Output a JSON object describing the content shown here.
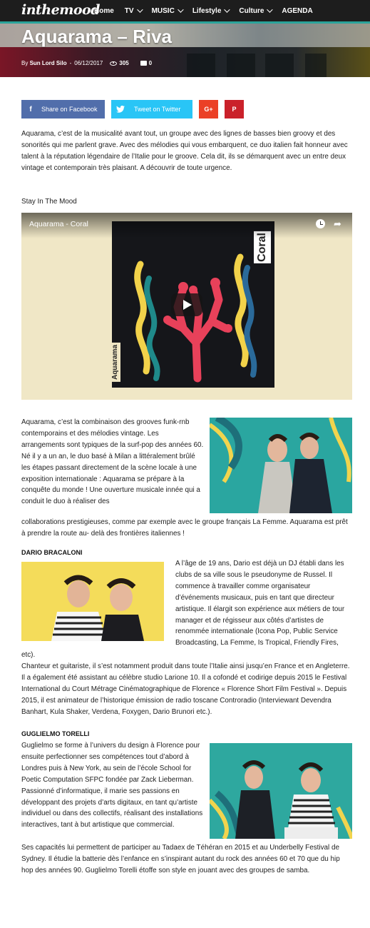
{
  "site": {
    "logo": "inthemood",
    "nav": [
      {
        "label": "Home",
        "has_dropdown": false
      },
      {
        "label": "TV",
        "has_dropdown": true
      },
      {
        "label": "MUSIC",
        "has_dropdown": true
      },
      {
        "label": "Lifestyle",
        "has_dropdown": true
      },
      {
        "label": "Culture",
        "has_dropdown": true
      },
      {
        "label": "AGENDA",
        "has_dropdown": false
      }
    ],
    "accent": "#2aa39a"
  },
  "article": {
    "title": "Aquarama – Riva",
    "by": "By",
    "author": "Sun Lord Silo",
    "date_sep": "-",
    "date": "06/12/2017",
    "views": "305",
    "comments": "0"
  },
  "share": {
    "facebook_label": "Share on Facebook",
    "twitter_label": "Tweet on Twitter",
    "googleplus_label": "G+",
    "pinterest_label": "P",
    "facebook_icon": "f",
    "colors": {
      "facebook": "#516eab",
      "twitter": "#29c5f6",
      "googleplus": "#eb4026",
      "pinterest": "#ca212a"
    }
  },
  "content": {
    "intro": "Aquarama, c’est de la musicalité avant tout, un groupe avec des lignes de basses bien groovy et des sonorités qui me parlent grave. Avec des mélodies qui vous embarquent, ce duo italien fait honneur avec talent à la réputation légendaire de l’Italie pour le groove. Cela dit, ils se démarquent avec un entre deux vintage et contemporain très plaisant. A découvrir de toute urgence.",
    "stay": "Stay In The Mood",
    "video": {
      "title": "Aquarama - Coral",
      "cover_title": "Coral",
      "cover_artist": "Aquarama"
    },
    "para2": "Aquarama, c’est la combinaison des grooves funk-rnb contemporains et des mélodies vintage. Les arrangements sont typiques de la surf-pop des années 60. Né il y a un an, le duo basé à Milan a littéralement brûlé les étapes passant directement de la scène locale à une exposition internationale : Aquarama se prépare à la conquête du monde ! Une ouverture musicale innée qui a conduit le duo à réaliser des",
    "para2b": "collaborations prestigieuses, comme par exemple avec le groupe français La Femme. Aquarama est prêt à prendre la route au- delà des frontières italiennes !",
    "dario_heading": "DARIO BRACALONI",
    "dario_p1": "A l’âge de 19 ans, Dario est déjà un DJ établi dans les clubs de sa ville sous le pseudonyme de Russel. Il commence à travailler comme organisateur d’événements musicaux, puis en tant que directeur artistique. Il élargit son expérience aux métiers de tour manager et de régisseur aux côtés d’artistes de renommée internationale (Icona Pop, Public Service Broadcasting, La Femme, Is Tropical, Friendly Fires,",
    "dario_p1b": "etc).",
    "dario_p2": "Chanteur et guitariste, il s’est notamment produit dans toute l’Italie ainsi jusqu’en France et en Angleterre. Il a également été assistant au célèbre studio Larione 10. Il a cofondé et codirige depuis 2015 le Festival International du Court Métrage Cinématographique de Florence « Florence Short Film Festival ». Depuis 2015, il est animateur de l’historique émission de radio toscane Controradio (Interviewant Devendra Banhart, Kula Shaker, Verdena, Foxygen, Dario Brunori etc.).",
    "guglielmo_heading": "GUGLIELMO TORELLI",
    "guglielmo_p1": "Guglielmo se forme à l’univers du design à Florence pour ensuite perfectionner ses compétences tout d’abord à Londres puis à New York, au sein de l’école School for Poetic Computation SFPC fondée par Zack Lieberman. Passionné d’informatique, il marie ses passions en développant des projets d’arts digitaux, en tant qu’artiste individuel ou dans des collectifs, réalisant des installations interactives, tant à but artistique que commercial.",
    "guglielmo_p2": "Ses capacités lui permettent de participer au Tadaex de Téhéran en 2015 et au Underbelly Festival de Sydney. Il étudie la batterie dès l’enfance en s’inspirant autant du rock des années 60 et 70 que du hip hop des années 90. Guglielmo Torelli étoffe son style en jouant avec des groupes de samba."
  }
}
